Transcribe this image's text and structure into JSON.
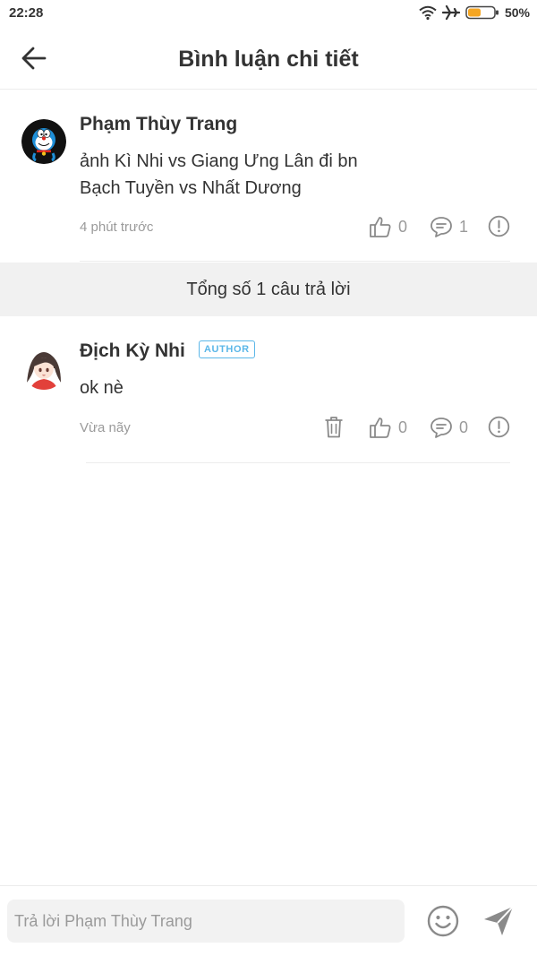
{
  "status_bar": {
    "time": "22:28",
    "battery_percent": "50%",
    "battery_level": 0.5,
    "icons": [
      "wifi-icon",
      "airplane-icon",
      "battery-icon"
    ]
  },
  "header": {
    "title": "Bình luận chi tiết",
    "back_icon": "arrow-left-icon"
  },
  "main_comment": {
    "author": "Phạm Thùy Trang",
    "text_line1": "ảnh Kì Nhi vs Giang Ưng Lân đi bn",
    "text_line2": "Bạch Tuyền vs Nhất Dương",
    "time": "4 phút trước",
    "likes": "0",
    "replies": "1",
    "avatar_icon": "doraemon-avatar"
  },
  "summary": {
    "text": "Tổng số 1 câu trả lời"
  },
  "reply": {
    "author": "Địch Kỳ Nhi",
    "badge": "AUTHOR",
    "text": "ok nè",
    "time": "Vừa nãy",
    "likes": "0",
    "replies": "0",
    "avatar_icon": "anime-girl-avatar"
  },
  "bottom_bar": {
    "placeholder": "Trả lời Phạm Thùy Trang",
    "emoji_icon": "smiley-icon",
    "send_icon": "send-icon"
  },
  "colors": {
    "text": "#333333",
    "muted": "#9a9a9a",
    "badge": "#5bb7e8",
    "summary_bg": "#f1f1f1",
    "battery": "#f5a623"
  }
}
